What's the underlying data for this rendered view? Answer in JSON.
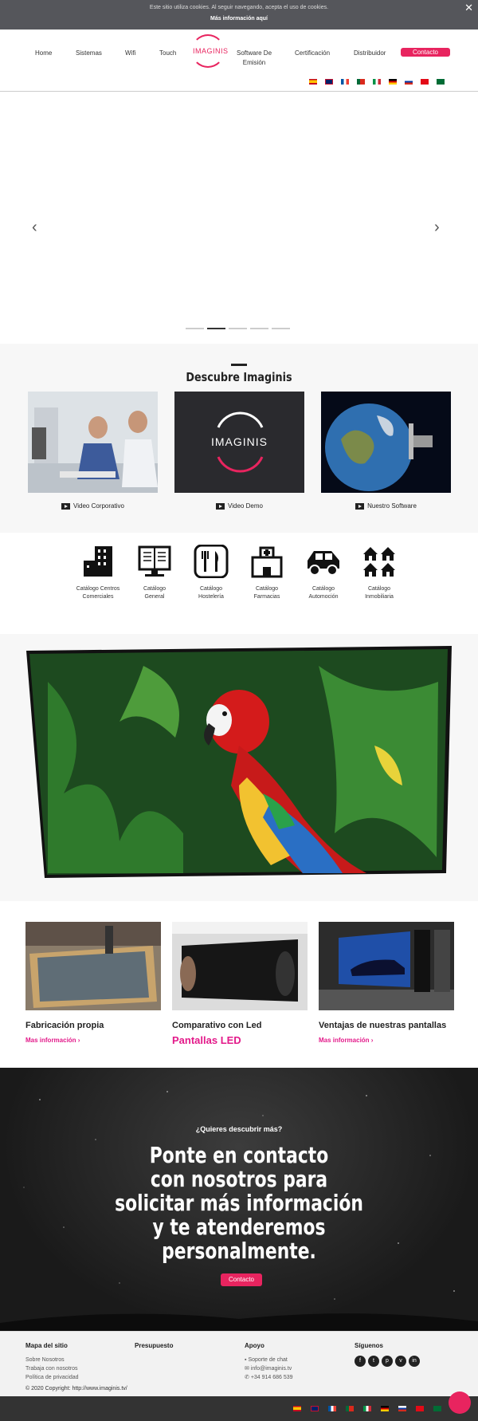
{
  "cookie": {
    "message": "Este sitio utiliza cookies. Al seguir navegando, acepta el uso de cookies.",
    "more": "Más información aquí",
    "close": "✕"
  },
  "nav": {
    "home": "Home",
    "sistemas": "Sistemas",
    "wifi": "Wifi",
    "touch": "Touch",
    "logo": "IMAGINIS",
    "software_line1": "Software De",
    "software_line2": "Emisión",
    "certificacion": "Certificación",
    "distribuidor": "Distribuidor",
    "contacto": "Contacto"
  },
  "flags": [
    "es",
    "gb",
    "fr",
    "pt",
    "it",
    "de",
    "ru",
    "tr",
    "sa"
  ],
  "hero": {
    "prev": "‹",
    "next": "›",
    "slides": 5,
    "active": 1
  },
  "discover": {
    "title": "Descubre Imaginis",
    "videos": [
      {
        "label": "Video Corporativo"
      },
      {
        "label": "Video Demo",
        "logo": "IMAGINIS"
      },
      {
        "label": "Nuestro Software"
      }
    ]
  },
  "catalogs": [
    {
      "line1": "Catálogo Centros",
      "line2": "Comerciales",
      "icon": "building-icon"
    },
    {
      "line1": "Catálogo",
      "line2": "General",
      "icon": "book-icon"
    },
    {
      "line1": "Catálogo",
      "line2": "Hostelería",
      "icon": "cutlery-icon"
    },
    {
      "line1": "Catálogo",
      "line2": "Farmacias",
      "icon": "pharmacy-icon"
    },
    {
      "line1": "Catálogo",
      "line2": "Automoción",
      "icon": "car-icon"
    },
    {
      "line1": "Catálogo",
      "line2": "Inmobiliaria",
      "icon": "houses-icon"
    }
  ],
  "features": [
    {
      "title": "Fabricación propia",
      "link": "Mas información ›"
    },
    {
      "title": "Comparativo con Led",
      "big": "Pantallas LED"
    },
    {
      "title": "Ventajas de nuestras pantallas",
      "link": "Mas información ›"
    }
  ],
  "cta": {
    "question": "¿Quieres descubrir más?",
    "line1": "Ponte en contacto",
    "line2": "con nosotros para",
    "line3": "solicitar más información",
    "line4": "y te atenderemos",
    "line5": "personalmente.",
    "button": "Contacto"
  },
  "footer": {
    "sitemap": {
      "title": "Mapa del sitio",
      "links": [
        "Sobre Nosotros",
        "Trabaja con nosotros",
        "Política de privacidad"
      ]
    },
    "budget": {
      "title": "Presupuesto"
    },
    "support": {
      "title": "Apoyo",
      "chat": "Soporte de chat",
      "email": "info@imaginis.tv",
      "phone": "+34 914 686 539"
    },
    "follow": {
      "title": "Síguenos",
      "icons": [
        "f",
        "t",
        "p",
        "v",
        "in"
      ]
    },
    "copyright": "© 2020 Copyright: http://www.imaginis.tv/"
  },
  "colors": {
    "accent": "#e8245f",
    "link": "#e31a8a"
  }
}
